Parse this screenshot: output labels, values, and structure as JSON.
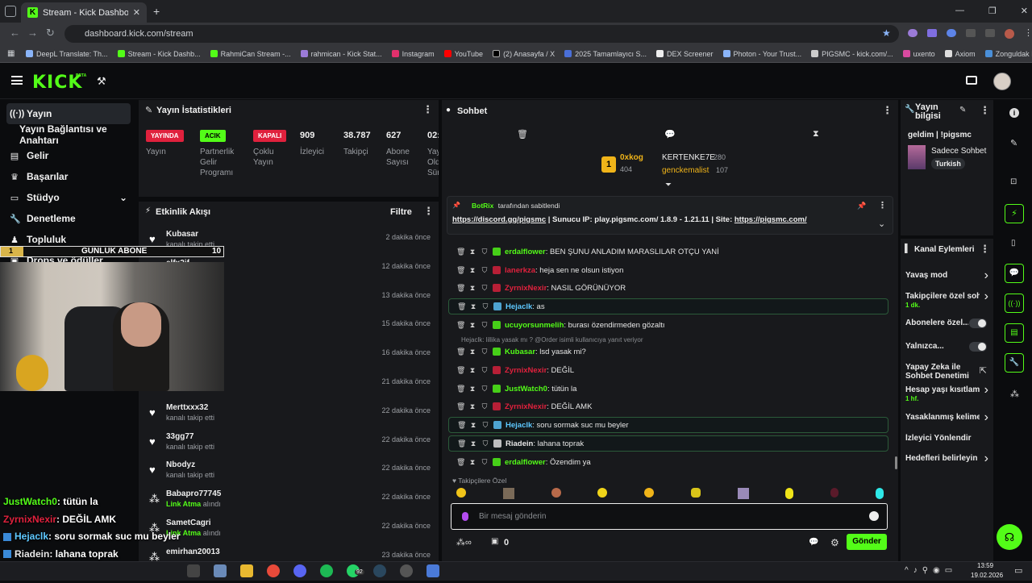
{
  "browser": {
    "tab_title": "Stream - Kick Dashboard",
    "url": "dashboard.kick.com/stream",
    "bookmarks": [
      "DeepL Translate: Th...",
      "Stream - Kick Dashb...",
      "RahmiCan Stream -...",
      "rahmican - Kick Stat...",
      "Instagram",
      "YouTube",
      "(2) Anasayfa / X",
      "2025 Tamamlayıcı S...",
      "DEX Screener",
      "Photon - Your Trust...",
      "PIGSMC - kick.com/...",
      "uxento",
      "Axiom",
      "Zonguldak İngilizce..."
    ]
  },
  "header": {
    "logo": "KICK",
    "beta": "BETA"
  },
  "sidebar": {
    "items": [
      {
        "label": "Yayın",
        "icon": "broadcast-icon"
      },
      {
        "label": "Yayın Bağlantısı ve Anahtarı"
      },
      {
        "label": "Gelir",
        "icon": "money-icon"
      },
      {
        "label": "Başarılar",
        "icon": "trophy-icon"
      },
      {
        "label": "Stüdyo",
        "icon": "studio-icon"
      },
      {
        "label": "Denetleme",
        "icon": "wrench-icon"
      },
      {
        "label": "Topluluk",
        "icon": "community-icon"
      },
      {
        "label": "Drops ve ödüller"
      }
    ]
  },
  "stats": {
    "title": "Yayın İstatistikleri",
    "items": [
      {
        "badge": "YAYINDA",
        "label": "Yayın",
        "color": "#e0213d"
      },
      {
        "badge": "ACIK",
        "label": "Partnerlik Gelir Programı",
        "color": "#53fc18"
      },
      {
        "badge": "KAPALI",
        "label": "Çoklu Yayın",
        "color": "#e0213d"
      },
      {
        "value": "909",
        "label": "İzleyici"
      },
      {
        "value": "38.787",
        "label": "Takipçi"
      },
      {
        "value": "627",
        "label": "Abone Sayısı"
      },
      {
        "value": "02:",
        "label": "Yayın Oldu Süre"
      }
    ]
  },
  "activity": {
    "title": "Etkinlik Akışı",
    "filter": "Filtre",
    "rows": [
      {
        "name": "Kubasar",
        "sub": "kanalı takip etti",
        "time": "2 dakika önce",
        "type": "follow"
      },
      {
        "name": "elfx2if",
        "sub": "",
        "time": "12 dakika önce",
        "type": "follow"
      },
      {
        "name": "",
        "sub": "",
        "time": "13 dakika önce",
        "type": "follow"
      },
      {
        "name": "",
        "sub": "",
        "time": "15 dakika önce",
        "type": "follow"
      },
      {
        "name": "",
        "sub": "",
        "time": "16 dakika önce",
        "type": "follow"
      },
      {
        "name": "",
        "sub": "alındı",
        "link": "Link Atma",
        "time": "21 dakika önce",
        "type": "reward"
      },
      {
        "name": "Merttxxx32",
        "sub": "kanalı takip etti",
        "time": "22 dakika önce",
        "type": "follow"
      },
      {
        "name": "33gg77",
        "sub": "kanalı takip etti",
        "time": "22 dakika önce",
        "type": "follow"
      },
      {
        "name": "Nbodyz",
        "sub": "kanalı takip etti",
        "time": "22 dakika önce",
        "type": "follow"
      },
      {
        "name": "Babapro77745",
        "sub": "alındı",
        "link": "Link Atma",
        "time": "22 dakika önce",
        "type": "reward"
      },
      {
        "name": "SametCagri",
        "sub": "alındı",
        "link": "Link Atma",
        "time": "22 dakika önce",
        "type": "reward"
      },
      {
        "name": "emirhan20013",
        "sub": "",
        "time": "23 dakika önce",
        "type": "reward"
      }
    ]
  },
  "overlay": {
    "goal_label": "GUNLUK ABONE",
    "goal_start": "1",
    "goal_end": "10",
    "chat": [
      {
        "user": "JustWatch0",
        "text": ": tütün la",
        "color": "#53fc18"
      },
      {
        "user": "ZyrnixNexir",
        "text": ": DEĞİL AMK",
        "color": "#e0213d"
      },
      {
        "user": "Hejaclk",
        "text": ": soru sormak suc mu beyler",
        "color": "#5ec8ff"
      },
      {
        "user": "Riadein",
        "text": ": lahana toprak",
        "color": "#e8e8e8"
      },
      {
        "user": "erdalflower",
        "text": ": Özendim ya",
        "color": "#53fc18"
      }
    ]
  },
  "chat": {
    "title": "Sohbet",
    "top_users": [
      {
        "rank": "1",
        "name": "0xkog",
        "count": "404"
      },
      {
        "name": "KERTENKE7E",
        "count": "280"
      },
      {
        "name": "genckemalist",
        "count": "107"
      }
    ],
    "pinned": {
      "by": "BotRix",
      "by_suffix": "tarafından sabitlendi",
      "link1": "https://discord.gg/pigsmc",
      "mid": " | Sunucu IP: play.pigsmc.com/ 1.8.9 - 1.21.11 | Site: ",
      "link2": "https://pigsmc.com/"
    },
    "messages": [
      {
        "user": "erdalflower",
        "text": ": BEN ŞUNU ANLADIM MARASLILAR OTÇU YANİ",
        "color": "#53fc18",
        "hl": false
      },
      {
        "user": "lanerkza",
        "text": ": heja sen ne olsun istiyon",
        "color": "#e0213d",
        "hl": false
      },
      {
        "user": "ZyrnixNexir",
        "text": ": NASIL GÖRÜNÜYOR",
        "color": "#e0213d",
        "hl": false
      },
      {
        "user": "Hejaclk",
        "text": ": as",
        "color": "#5ec8ff",
        "hl": true
      },
      {
        "user": "ucuyorsunmelih",
        "text": ": burası özendirmeden gözaltı",
        "color": "#53fc18",
        "hl": false
      },
      {
        "user": "Kubasar",
        "text": ": lsd yasak mi?",
        "color": "#53fc18",
        "hl": false
      },
      {
        "user": "ZyrnixNexir",
        "text": ": DEĞİL",
        "color": "#e0213d",
        "hl": false
      },
      {
        "user": "JustWatch0",
        "text": ": tütün la",
        "color": "#53fc18",
        "hl": false
      },
      {
        "user": "ZyrnixNexir",
        "text": ": DEĞİL AMK",
        "color": "#e0213d",
        "hl": false
      },
      {
        "user": "Hejaclk",
        "text": ": soru sormak suc mu beyler",
        "color": "#5ec8ff",
        "hl": true
      },
      {
        "user": "Riadein",
        "text": ": lahana toprak",
        "color": "#e8e8e8",
        "hl": true
      },
      {
        "user": "erdalflower",
        "text": ": Özendim ya",
        "color": "#53fc18",
        "hl": false
      }
    ],
    "reply_hint": "Hejaclk: lillika yasak mı ? @Order isimli kullanıcıya yanıt veriyor",
    "followers_only": "Takipçilere Özel",
    "input_placeholder": "Bir mesaj gönderin",
    "count_label": "0",
    "send": "Gönder"
  },
  "stream_info": {
    "title": "Yayın bilgisi",
    "stream_title": "geldim | !pigsmc",
    "category": "Sadece Sohbet",
    "language": "Turkish"
  },
  "channel_actions": {
    "title": "Kanal Eylemleri",
    "items": [
      {
        "label": "Yavaş mod",
        "kind": "arrow"
      },
      {
        "label": "Takipçilere özel soh",
        "sub": "1 dk.",
        "kind": "arrow"
      },
      {
        "label": "Abonelere özel...",
        "kind": "toggle"
      },
      {
        "label": "Yalnızca...",
        "kind": "toggle"
      },
      {
        "label": "Yapay Zeka ile Sohbet Denetimi",
        "kind": "external"
      },
      {
        "label": "Hesap yaşı kısıtlama",
        "sub": "1 hf.",
        "kind": "arrow"
      },
      {
        "label": "Yasaklanmış kelime",
        "kind": "arrow"
      },
      {
        "label": "İzleyici Yönlendir",
        "kind": "none"
      },
      {
        "label": "Hedefleri belirleyin",
        "kind": "arrow"
      }
    ]
  },
  "taskbar": {
    "time": "13:59",
    "date": "19.02.2026",
    "wa_badge": "92"
  }
}
